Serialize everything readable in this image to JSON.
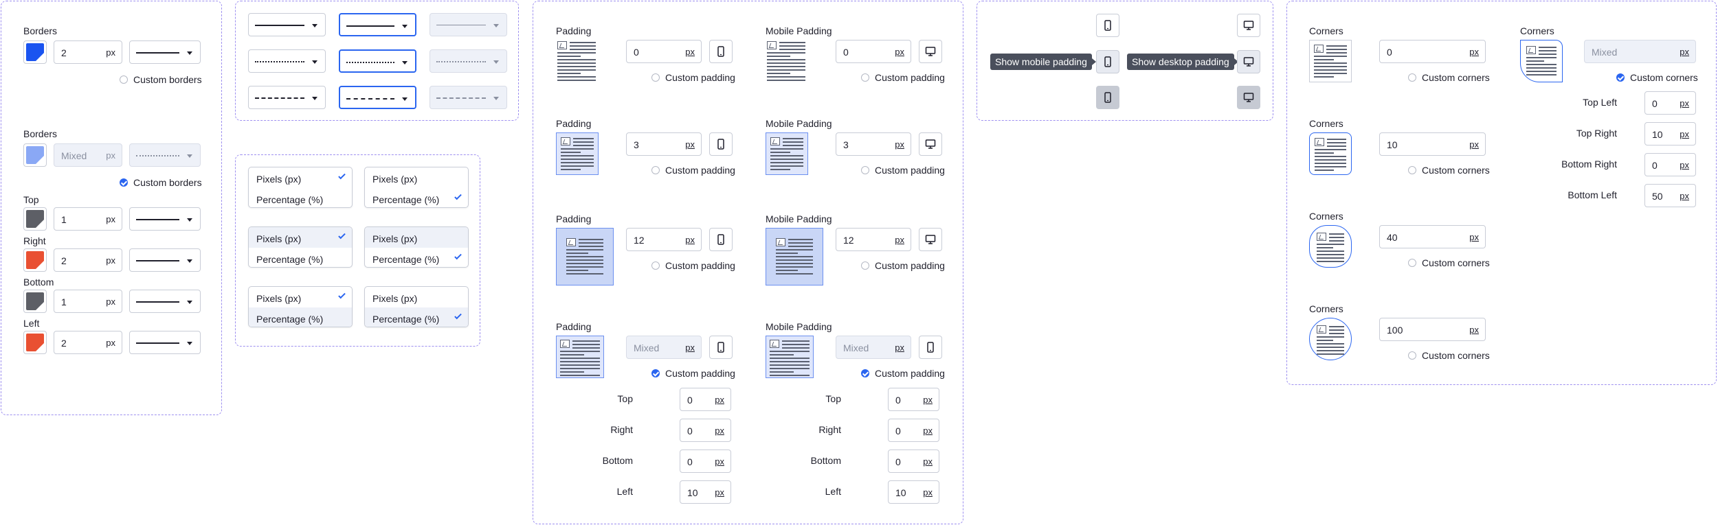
{
  "colors": {
    "accent": "#2a65f0",
    "border_dashed": "#9d8ff0",
    "swatch_blue": "#1a54f0",
    "swatch_light_blue": "#8aa8f5",
    "swatch_gray": "#5d5f66",
    "swatch_red": "#e95032"
  },
  "icons": {
    "mobile": "mobile-device-icon",
    "desktop": "desktop-monitor-icon",
    "image": "image-icon",
    "check": "check-icon",
    "caret": "chevron-down-icon"
  },
  "borders": {
    "label": "Borders",
    "value": "2",
    "unit": "px",
    "custom_label": "Custom borders",
    "label2": "Borders",
    "value2": "Mixed",
    "unit2": "px",
    "custom_label2": "Custom borders",
    "sides": [
      {
        "label": "Top",
        "value": "1",
        "unit": "px"
      },
      {
        "label": "Right",
        "value": "2",
        "unit": "px"
      },
      {
        "label": "Bottom",
        "value": "1",
        "unit": "px"
      },
      {
        "label": "Left",
        "value": "2",
        "unit": "px"
      }
    ]
  },
  "units": {
    "pixels": "Pixels (px)",
    "percentage": "Percentage (%)"
  },
  "padding": {
    "label": "Padding",
    "mobile_label": "Mobile Padding",
    "custom_label": "Custom padding",
    "unit": "px",
    "values": [
      "0",
      "3",
      "12",
      "Mixed"
    ],
    "mobile_values": [
      "0",
      "3",
      "12",
      "Mixed"
    ],
    "sides": [
      {
        "label": "Top",
        "value": "0",
        "unit": "px"
      },
      {
        "label": "Right",
        "value": "0",
        "unit": "px"
      },
      {
        "label": "Bottom",
        "value": "0",
        "unit": "px"
      },
      {
        "label": "Left",
        "value": "10",
        "unit": "px"
      }
    ]
  },
  "tooltips": {
    "mobile": "Show mobile padding",
    "desktop": "Show desktop padding"
  },
  "corners": {
    "label": "Corners",
    "custom_label": "Custom corners",
    "unit": "px",
    "values": [
      "0",
      "10",
      "40",
      "100"
    ],
    "mixed_value": "Mixed",
    "sides": [
      {
        "label": "Top Left",
        "value": "0",
        "unit": "px"
      },
      {
        "label": "Top Right",
        "value": "10",
        "unit": "px"
      },
      {
        "label": "Bottom Right",
        "value": "0",
        "unit": "px"
      },
      {
        "label": "Bottom Left",
        "value": "50",
        "unit": "px"
      }
    ]
  }
}
